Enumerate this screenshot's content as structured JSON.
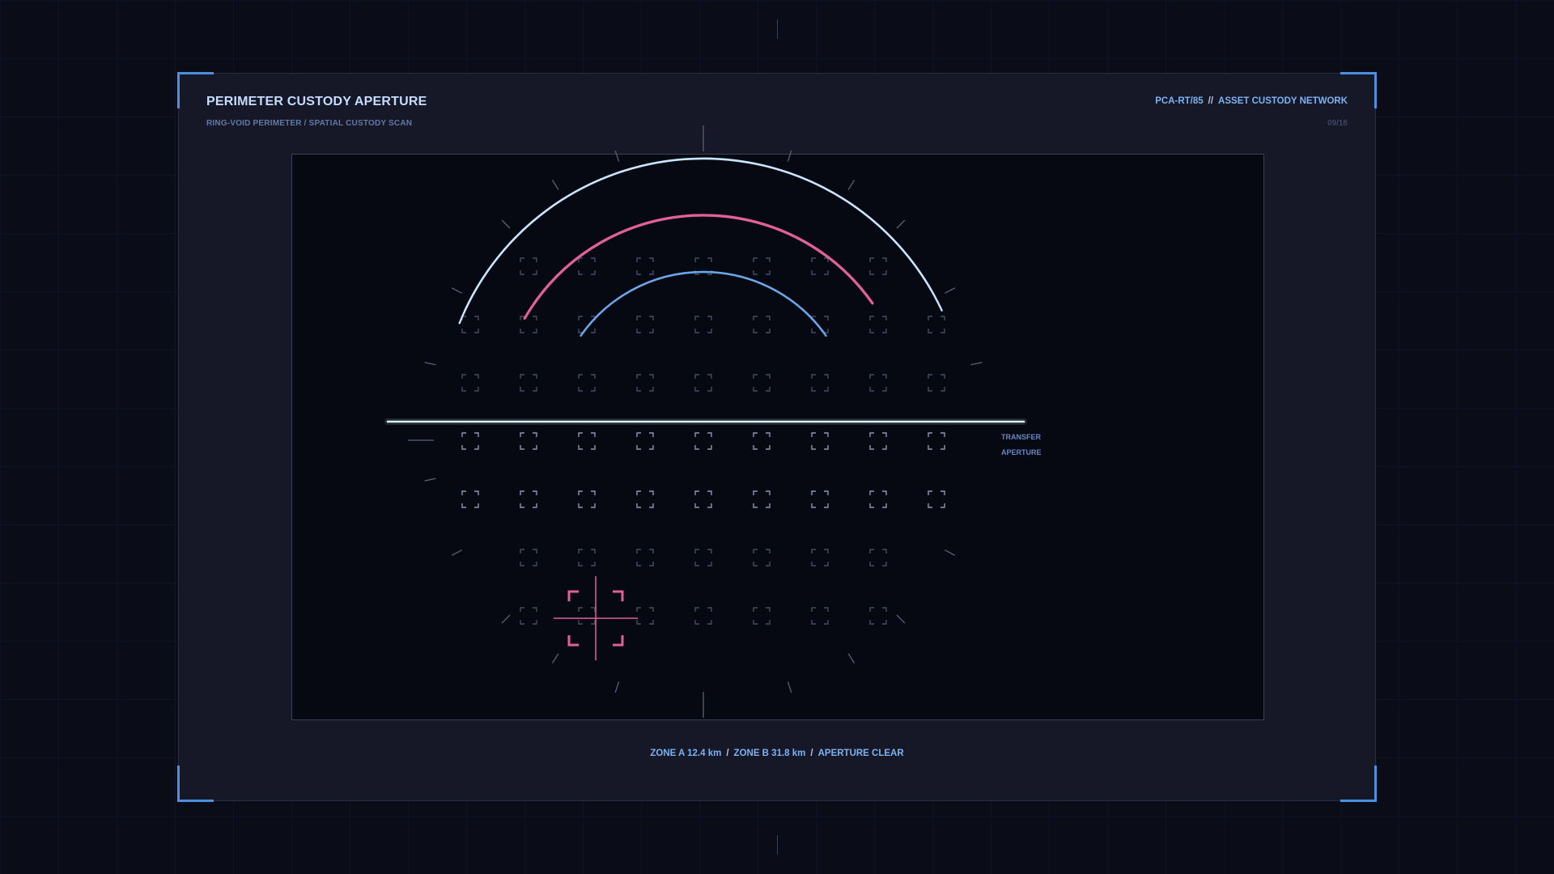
{
  "header": {
    "title": "PERIMETER CUSTODY APERTURE",
    "subtitle": "RING-VOID PERIMETER / SPATIAL CUSTODY SCAN",
    "code": "PCA-RT/85",
    "separator": "//",
    "network": "ASSET CUSTODY NETWORK",
    "page": "09/18"
  },
  "diagram": {
    "aperture_label_line1": "TRANSFER",
    "aperture_label_line2": "APERTURE"
  },
  "footer": {
    "zone_a": "ZONE A 12.4 km",
    "zone_b": "ZONE B 31.8 km",
    "status": "APERTURE CLEAR",
    "separator": "/"
  },
  "colors": {
    "outer_ring": "#c8e6ff",
    "middle_ring": "#e0609a",
    "inner_ring": "#6aa6ea",
    "aperture_bar": "#d8f2ff",
    "target_reticle": "#e0609a",
    "accent": "#4d8fe0"
  },
  "icons": {
    "grid_marker": "corner-bracket-icon",
    "target": "crosshair-reticle-icon"
  }
}
